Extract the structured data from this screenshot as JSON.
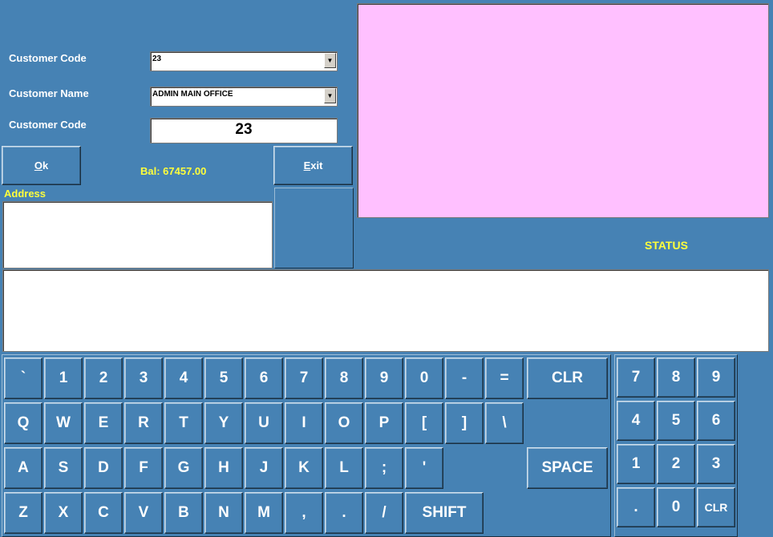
{
  "form": {
    "customer_code_label": "Customer Code",
    "customer_code_value": "23",
    "customer_name_label": "Customer Name",
    "customer_name_value": "ADMIN MAIN OFFICE",
    "customer_code2_label": "Customer Code",
    "customer_code2_value": "23",
    "ok_label_u": "O",
    "ok_label_rest": "k",
    "balance": "Bal: 67457.00",
    "exit_label_u": "E",
    "exit_label_rest": "xit",
    "address_label": "Address",
    "status_label": "STATUS"
  },
  "keyboard": {
    "row1": [
      "`",
      "1",
      "2",
      "3",
      "4",
      "5",
      "6",
      "7",
      "8",
      "9",
      "0",
      "-",
      "=",
      "CLR"
    ],
    "row2": [
      "Q",
      "W",
      "E",
      "R",
      "T",
      "Y",
      "U",
      "I",
      "O",
      "P",
      "[",
      "]",
      "\\"
    ],
    "row3": [
      "A",
      "S",
      "D",
      "F",
      "G",
      "H",
      "J",
      "K",
      "L",
      ";",
      "'",
      "SPACE"
    ],
    "row4": [
      "Z",
      "X",
      "C",
      "V",
      "B",
      "N",
      "M",
      ",",
      ".",
      "/",
      "SHIFT"
    ]
  },
  "numpad": {
    "keys": [
      "7",
      "8",
      "9",
      "4",
      "5",
      "6",
      "1",
      "2",
      "3",
      ".",
      "0",
      "CLR"
    ]
  },
  "colors": {
    "background": "#4682b4",
    "display_panel": "#ffc0ff",
    "highlight_text": "#ffff3c"
  }
}
